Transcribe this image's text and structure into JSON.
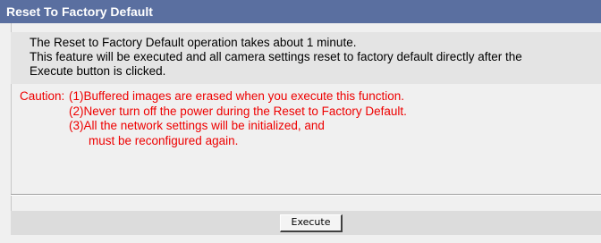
{
  "header": {
    "title": "Reset To Factory Default"
  },
  "description": {
    "line1": "The Reset to Factory Default operation takes about 1 minute.",
    "line2": "This feature will be executed and all camera settings reset to factory default directly after the",
    "line3": "Execute button is clicked."
  },
  "caution": {
    "lead": "Caution:",
    "items": [
      {
        "num": "(1)",
        "text": "Buffered images are erased when you execute this function."
      },
      {
        "num": "(2)",
        "text": "Never turn off the power during the Reset to Factory Default."
      },
      {
        "num": "(3)",
        "text": "All the network settings will be initialized, and",
        "cont": "must be reconfigured again."
      }
    ]
  },
  "actions": {
    "execute_label": "Execute"
  },
  "colors": {
    "header_bg": "#5a6fa0",
    "caution_text": "#ee0000"
  }
}
